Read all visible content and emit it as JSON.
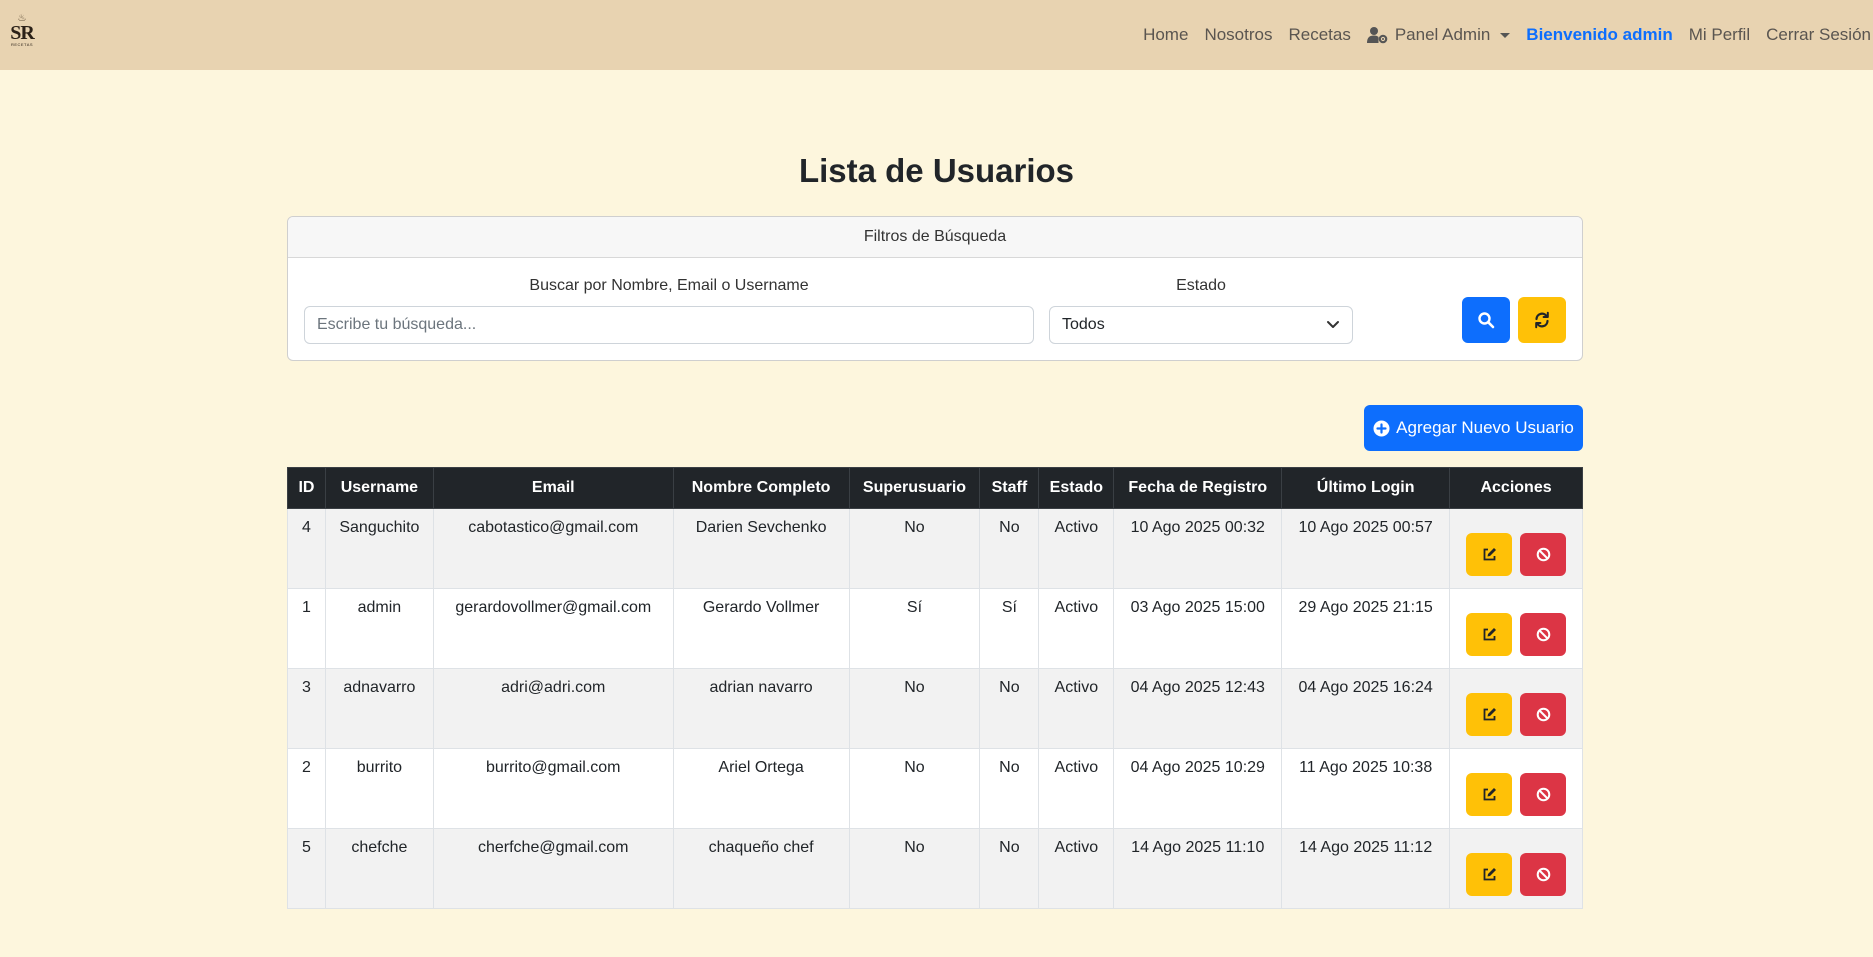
{
  "brand": {
    "logo_text": "SR",
    "logo_sub": "RECETAS"
  },
  "nav": {
    "home": "Home",
    "about": "Nosotros",
    "recipes": "Recetas",
    "admin_panel": "Panel Admin",
    "welcome": "Bienvenido admin",
    "profile": "Mi Perfil",
    "logout": "Cerrar Sesión"
  },
  "page": {
    "title": "Lista de Usuarios"
  },
  "filters": {
    "header": "Filtros de Búsqueda",
    "search_label": "Buscar por Nombre, Email o Username",
    "search_placeholder": "Escribe tu búsqueda...",
    "search_value": "",
    "status_label": "Estado",
    "status_selected": "Todos",
    "search_button_icon": "search-icon",
    "reset_button_icon": "refresh-icon"
  },
  "add_button": {
    "label": "Agregar Nuevo Usuario",
    "icon": "plus-circle-icon"
  },
  "table": {
    "headers": [
      "ID",
      "Username",
      "Email",
      "Nombre Completo",
      "Superusuario",
      "Staff",
      "Estado",
      "Fecha de Registro",
      "Último Login",
      "Acciones"
    ],
    "rows": [
      {
        "id": "4",
        "username": "Sanguchito",
        "email": "cabotastico@gmail.com",
        "full_name": "Darien Sevchenko",
        "superuser": "No",
        "staff": "No",
        "status": "Activo",
        "registered": "10 Ago 2025 00:32",
        "last_login": "10 Ago 2025 00:57"
      },
      {
        "id": "1",
        "username": "admin",
        "email": "gerardovollmer@gmail.com",
        "full_name": "Gerardo Vollmer",
        "superuser": "Sí",
        "staff": "Sí",
        "status": "Activo",
        "registered": "03 Ago 2025 15:00",
        "last_login": "29 Ago 2025 21:15"
      },
      {
        "id": "3",
        "username": "adnavarro",
        "email": "adri@adri.com",
        "full_name": "adrian navarro",
        "superuser": "No",
        "staff": "No",
        "status": "Activo",
        "registered": "04 Ago 2025 12:43",
        "last_login": "04 Ago 2025 16:24"
      },
      {
        "id": "2",
        "username": "burrito",
        "email": "burrito@gmail.com",
        "full_name": "Ariel Ortega",
        "superuser": "No",
        "staff": "No",
        "status": "Activo",
        "registered": "04 Ago 2025 10:29",
        "last_login": "11 Ago 2025 10:38"
      },
      {
        "id": "5",
        "username": "chefche",
        "email": "cherfche@gmail.com",
        "full_name": "chaqueño chef",
        "superuser": "No",
        "staff": "No",
        "status": "Activo",
        "registered": "14 Ago 2025 11:10",
        "last_login": "14 Ago 2025 11:12"
      }
    ]
  },
  "colors": {
    "navbar": "#e8d3b1",
    "background": "#fdf6dd",
    "primary": "#0d6efd",
    "warning": "#ffc107",
    "danger": "#dc3545",
    "table_header": "#212529"
  }
}
